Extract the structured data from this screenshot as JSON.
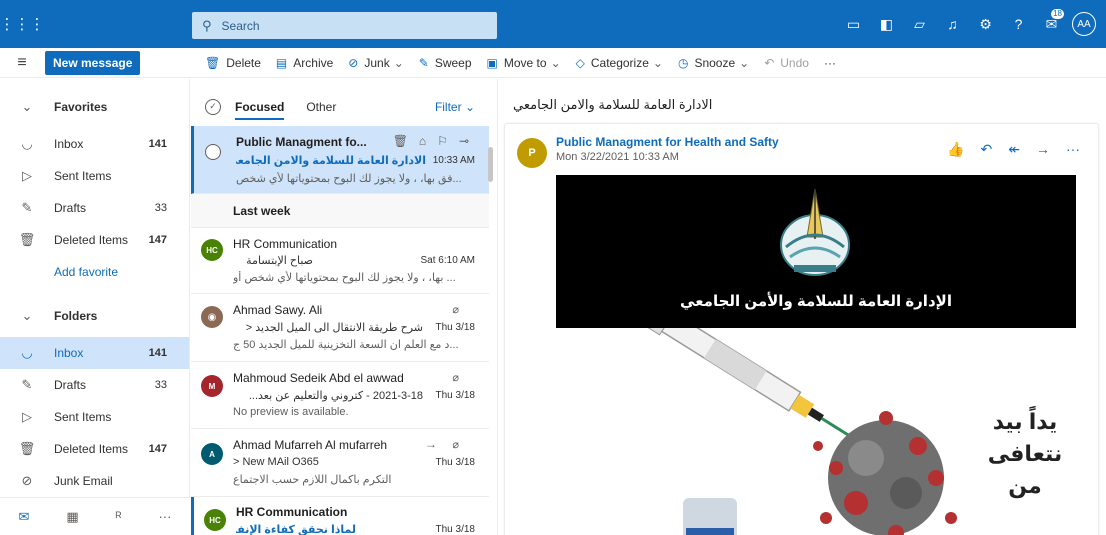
{
  "topbar": {
    "search_placeholder": "Search",
    "notification_count": "18",
    "user_initials": "AA"
  },
  "commandbar": {
    "new_message": "New message",
    "delete": "Delete",
    "archive": "Archive",
    "junk": "Junk",
    "sweep": "Sweep",
    "move_to": "Move to",
    "categorize": "Categorize",
    "snooze": "Snooze",
    "undo": "Undo",
    "more": "···"
  },
  "nav": {
    "favorites_header": "Favorites",
    "favorites": [
      {
        "label": "Inbox",
        "count": "141"
      },
      {
        "label": "Sent Items",
        "count": ""
      },
      {
        "label": "Drafts",
        "count": "33"
      },
      {
        "label": "Deleted Items",
        "count": "147"
      }
    ],
    "add_favorite": "Add favorite",
    "folders_header": "Folders",
    "folders": [
      {
        "label": "Inbox",
        "count": "141"
      },
      {
        "label": "Drafts",
        "count": "33"
      },
      {
        "label": "Sent Items",
        "count": ""
      },
      {
        "label": "Deleted Items",
        "count": "147"
      },
      {
        "label": "Junk Email",
        "count": ""
      }
    ]
  },
  "maillist": {
    "tab_focused": "Focused",
    "tab_other": "Other",
    "filter": "Filter",
    "last_week": "Last week",
    "items": [
      {
        "sender": "Public Managment fo...",
        "subject": "الادارة العامة للسلامة والامن الجامعي",
        "time": "10:33 AM",
        "preview": "...فق بها، ، ولا يجوز لك البوح بمحتوياتها لأي شخص"
      },
      {
        "sender": "HR Communication",
        "initials": "HC",
        "subject": "صباح الإبتسامة",
        "time": "Sat 6:10 AM",
        "preview": "... بها، ، ولا يجوز لك البوح بمحتوياتها لأي شخص أو"
      },
      {
        "sender": "Ahmad Sawy. Ali",
        "subject": "شرح طريقة الانتقال الى الميل الجديد  <",
        "time": "Thu 3/18",
        "preview": "...د مع العلم ان السعة التخزينية للميل الجديد 50 ج"
      },
      {
        "sender": "Mahmoud Sedeik Abd el awwad",
        "initials": "M",
        "subject": "2021-3-18 - كتروني والتعليم عن بعد...",
        "time": "Thu 3/18",
        "preview": "No preview is available."
      },
      {
        "sender": "Ahmad Mufarreh Al mufarreh",
        "initials": "A",
        "subject": "> New MAil O365",
        "time": "Thu 3/18",
        "preview": "التكرم باكمال اللازم حسب الاجتماع"
      },
      {
        "sender": "HR Communication",
        "initials": "HC",
        "subject": "لماذا نحقق كفاءة الإنفاق...؟",
        "time": "Thu 3/18",
        "preview": ""
      }
    ]
  },
  "reading": {
    "subject": "الادارة العامة للسلامة والامن الجامعي",
    "from": "Public Managment for Health and Safty",
    "avatar_initial": "P",
    "date": "Mon 3/22/2021 10:33 AM",
    "banner_text": "الإدارة العامة للسلامة والأمن الجامعي",
    "slogan_line1": "يداً بيد",
    "slogan_line2": "نتعافى",
    "slogan_line3": "من"
  },
  "colors": {
    "brand": "#0f6cbd",
    "selected": "#cfe4fa",
    "avatar_hc": "#498205",
    "avatar_m": "#a4262c",
    "avatar_a": "#005b70",
    "avatar_p": "#c19c00"
  }
}
